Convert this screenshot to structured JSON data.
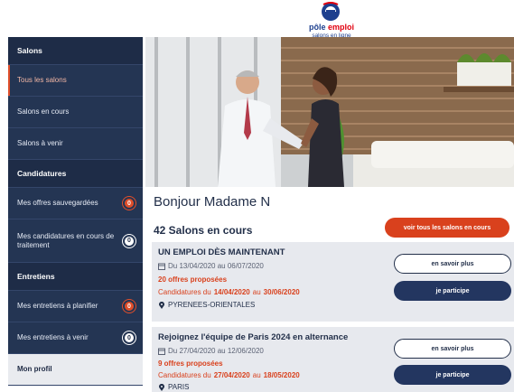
{
  "brand": {
    "name_prefix": "pôle",
    "name_suffix": "emploi",
    "subtitle": "salons en ligne"
  },
  "sidebar": {
    "sections": [
      {
        "label": "Salons",
        "items": [
          {
            "label": "Tous les salons"
          },
          {
            "label": "Salons en cours"
          },
          {
            "label": "Salons à venir"
          }
        ]
      },
      {
        "label": "Candidatures",
        "items": [
          {
            "label": "Mes offres sauvegardées",
            "badge": "0"
          },
          {
            "label": "Mes candidatures en cours de traitement",
            "badge": "0"
          }
        ]
      },
      {
        "label": "Entretiens",
        "items": [
          {
            "label": "Mes entretiens à planifier",
            "badge": "0"
          },
          {
            "label": "Mes entretiens à venir",
            "badge": "0"
          }
        ]
      }
    ],
    "profile_label": "Mon profil"
  },
  "main": {
    "greeting": "Bonjour Madame N",
    "count_label": "42 Salons en cours",
    "all_button": "voir tous les salons en cours",
    "cards": [
      {
        "title": "UN EMPLOI DÈS MAINTENANT",
        "dates": "Du 13/04/2020 au 06/07/2020",
        "offers": "20 offres proposées",
        "cand_prefix": "Candidatures du",
        "cand_start": "14/04/2020",
        "cand_mid": "au",
        "cand_end": "30/06/2020",
        "location": "PYRENEES-ORIENTALES",
        "more_label": "en savoir plus",
        "join_label": "je participe"
      },
      {
        "title": "Rejoignez l'équipe de Paris 2024 en alternance",
        "dates": "Du 27/04/2020 au 12/06/2020",
        "offers": "9 offres proposées",
        "cand_prefix": "Candidatures du",
        "cand_start": "27/04/2020",
        "cand_mid": "au",
        "cand_end": "18/05/2020",
        "location": "PARIS",
        "more_label": "en savoir plus",
        "join_label": "je participe"
      }
    ]
  },
  "colors": {
    "navy": "#243553",
    "accent": "#d9411d",
    "button_dark": "#233660"
  },
  "icons": {
    "calendar": "calendar-icon",
    "location": "location-pin-icon"
  }
}
